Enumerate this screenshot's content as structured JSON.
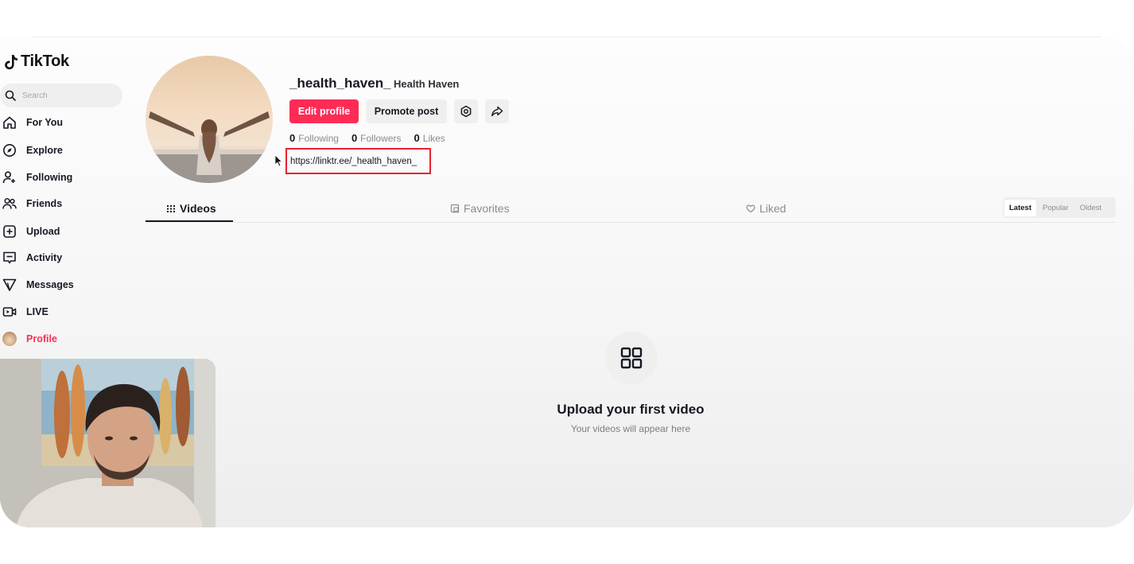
{
  "app": {
    "name": "TikTok"
  },
  "search": {
    "placeholder": "Search"
  },
  "sidebar": {
    "items": [
      {
        "label": "For You",
        "icon": "home-icon"
      },
      {
        "label": "Explore",
        "icon": "compass-icon"
      },
      {
        "label": "Following",
        "icon": "user-follow-icon"
      },
      {
        "label": "Friends",
        "icon": "friends-icon"
      },
      {
        "label": "Upload",
        "icon": "upload-plus-icon"
      },
      {
        "label": "Activity",
        "icon": "activity-icon"
      },
      {
        "label": "Messages",
        "icon": "send-icon"
      },
      {
        "label": "LIVE",
        "icon": "live-icon"
      },
      {
        "label": "Profile",
        "icon": "profile-avatar",
        "active": true
      }
    ]
  },
  "profile": {
    "username": "_health_haven_",
    "nickname": "Health Haven",
    "edit_label": "Edit profile",
    "promote_label": "Promote post",
    "stats": [
      {
        "value": "0",
        "label": "Following"
      },
      {
        "value": "0",
        "label": "Followers"
      },
      {
        "value": "0",
        "label": "Likes"
      }
    ],
    "bio_link": "https://linktr.ee/_health_haven_"
  },
  "tabs": [
    {
      "label": "Videos",
      "icon": "grid-icon",
      "active": true
    },
    {
      "label": "Favorites",
      "icon": "bookmark-icon"
    },
    {
      "label": "Liked",
      "icon": "heart-icon"
    }
  ],
  "sort": {
    "options": [
      "Latest",
      "Popular",
      "Oldest"
    ],
    "selected": "Latest"
  },
  "empty_state": {
    "title": "Upload your first video",
    "subtitle": "Your videos will appear here"
  },
  "colors": {
    "brand": "#fe2c55",
    "highlight_box": "#e5232f",
    "text": "#161823",
    "muted": "#8a8b91"
  }
}
